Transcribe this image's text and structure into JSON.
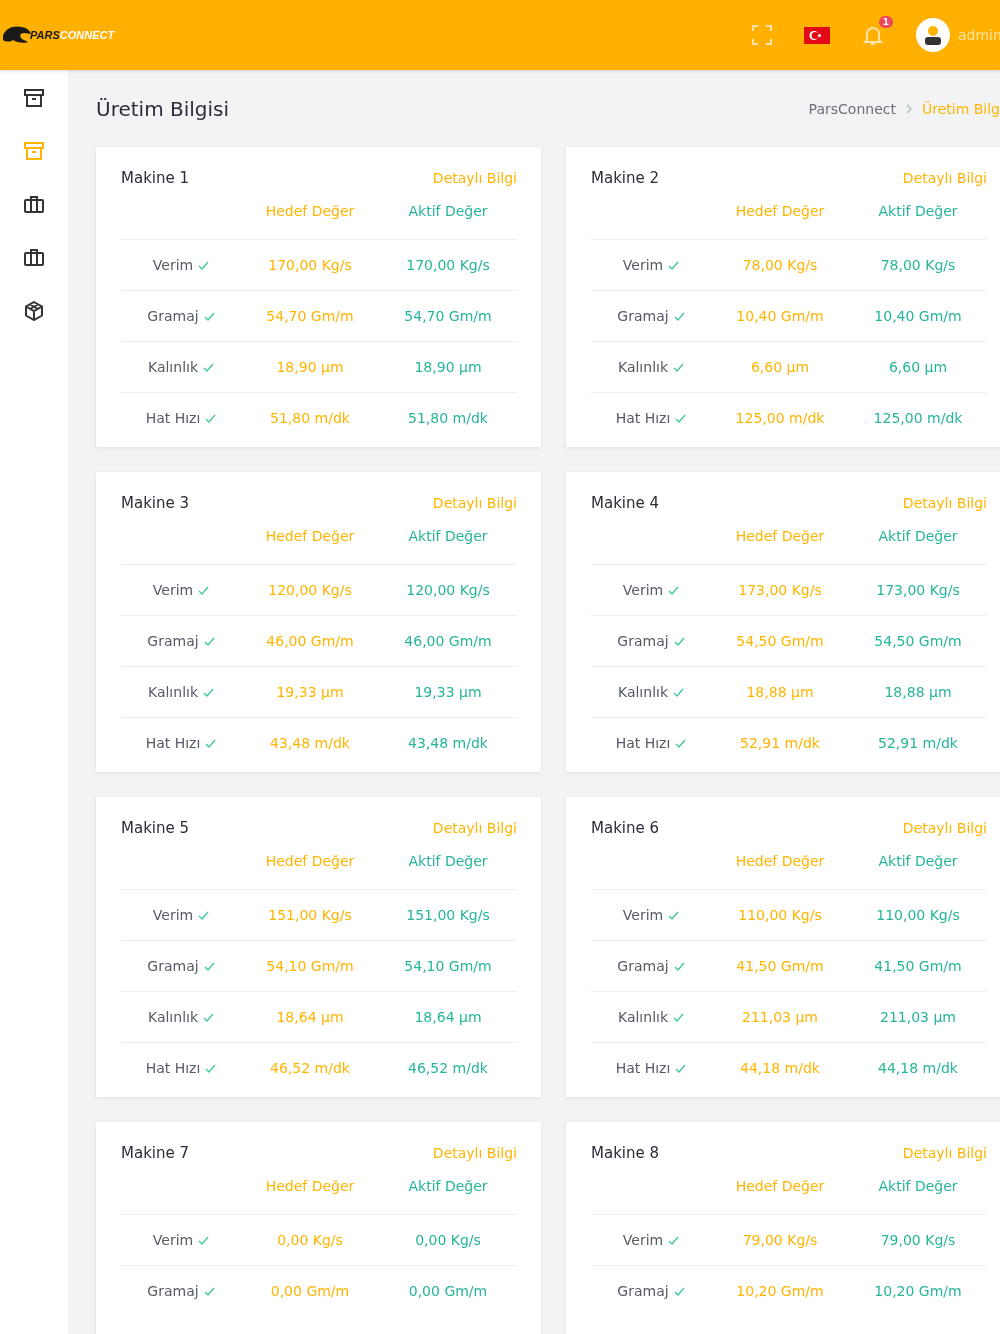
{
  "header": {
    "brand": {
      "first": "PARS",
      "second": "CONNECT"
    },
    "notifications": "1",
    "user": "admin"
  },
  "sidebar": {
    "items": [
      {
        "kind": "archive",
        "selected": false
      },
      {
        "kind": "archive",
        "selected": true
      },
      {
        "kind": "briefcase",
        "selected": false
      },
      {
        "kind": "briefcase",
        "selected": false
      },
      {
        "kind": "cube",
        "selected": false
      }
    ]
  },
  "page": {
    "title": "Üretim Bilgisi",
    "breadcrumb": [
      {
        "label": "ParsConnect",
        "selected": false
      },
      {
        "label": "Üretim Bilg",
        "selected": true
      }
    ]
  },
  "machines": [
    {
      "name": "Makine 1",
      "link": "Detaylı Bilgi",
      "target_header": "Hedef Değer",
      "actual_header": "Aktif Değer",
      "rows": [
        {
          "label": "Verim",
          "ok": true,
          "target": "170,00 Kg/s",
          "actual": "170,00 Kg/s"
        },
        {
          "label": "Gramaj",
          "ok": true,
          "target": "54,70 Gm/m",
          "actual": "54,70 Gm/m"
        },
        {
          "label": "Kalınlık",
          "ok": true,
          "target": "18,90 µm",
          "actual": "18,90 µm"
        },
        {
          "label": "Hat Hızı",
          "ok": true,
          "target": "51,80 m/dk",
          "actual": "51,80 m/dk"
        }
      ]
    },
    {
      "name": "Makine 2",
      "link": "Detaylı Bilgi",
      "target_header": "Hedef Değer",
      "actual_header": "Aktif Değer",
      "rows": [
        {
          "label": "Verim",
          "ok": true,
          "target": "78,00 Kg/s",
          "actual": "78,00 Kg/s"
        },
        {
          "label": "Gramaj",
          "ok": true,
          "target": "10,40 Gm/m",
          "actual": "10,40 Gm/m"
        },
        {
          "label": "Kalınlık",
          "ok": true,
          "target": "6,60 µm",
          "actual": "6,60 µm"
        },
        {
          "label": "Hat Hızı",
          "ok": true,
          "target": "125,00 m/dk",
          "actual": "125,00 m/dk"
        }
      ]
    },
    {
      "name": "Makine 3",
      "link": "Detaylı Bilgi",
      "target_header": "Hedef Değer",
      "actual_header": "Aktif Değer",
      "rows": [
        {
          "label": "Verim",
          "ok": true,
          "target": "120,00 Kg/s",
          "actual": "120,00 Kg/s"
        },
        {
          "label": "Gramaj",
          "ok": true,
          "target": "46,00 Gm/m",
          "actual": "46,00 Gm/m"
        },
        {
          "label": "Kalınlık",
          "ok": true,
          "target": "19,33 µm",
          "actual": "19,33 µm"
        },
        {
          "label": "Hat Hızı",
          "ok": true,
          "target": "43,48 m/dk",
          "actual": "43,48 m/dk"
        }
      ]
    },
    {
      "name": "Makine 4",
      "link": "Detaylı Bilgi",
      "target_header": "Hedef Değer",
      "actual_header": "Aktif Değer",
      "rows": [
        {
          "label": "Verim",
          "ok": true,
          "target": "173,00 Kg/s",
          "actual": "173,00 Kg/s"
        },
        {
          "label": "Gramaj",
          "ok": true,
          "target": "54,50 Gm/m",
          "actual": "54,50 Gm/m"
        },
        {
          "label": "Kalınlık",
          "ok": true,
          "target": "18,88 µm",
          "actual": "18,88 µm"
        },
        {
          "label": "Hat Hızı",
          "ok": true,
          "target": "52,91 m/dk",
          "actual": "52,91 m/dk"
        }
      ]
    },
    {
      "name": "Makine 5",
      "link": "Detaylı Bilgi",
      "target_header": "Hedef Değer",
      "actual_header": "Aktif Değer",
      "rows": [
        {
          "label": "Verim",
          "ok": true,
          "target": "151,00 Kg/s",
          "actual": "151,00 Kg/s"
        },
        {
          "label": "Gramaj",
          "ok": true,
          "target": "54,10 Gm/m",
          "actual": "54,10 Gm/m"
        },
        {
          "label": "Kalınlık",
          "ok": true,
          "target": "18,64 µm",
          "actual": "18,64 µm"
        },
        {
          "label": "Hat Hızı",
          "ok": true,
          "target": "46,52 m/dk",
          "actual": "46,52 m/dk"
        }
      ]
    },
    {
      "name": "Makine 6",
      "link": "Detaylı Bilgi",
      "target_header": "Hedef Değer",
      "actual_header": "Aktif Değer",
      "rows": [
        {
          "label": "Verim",
          "ok": true,
          "target": "110,00 Kg/s",
          "actual": "110,00 Kg/s"
        },
        {
          "label": "Gramaj",
          "ok": true,
          "target": "41,50 Gm/m",
          "actual": "41,50 Gm/m"
        },
        {
          "label": "Kalınlık",
          "ok": true,
          "target": "211,03 µm",
          "actual": "211,03 µm"
        },
        {
          "label": "Hat Hızı",
          "ok": true,
          "target": "44,18 m/dk",
          "actual": "44,18 m/dk"
        }
      ]
    },
    {
      "name": "Makine 7",
      "link": "Detaylı Bilgi",
      "target_header": "Hedef Değer",
      "actual_header": "Aktif Değer",
      "rows": [
        {
          "label": "Verim",
          "ok": true,
          "target": "0,00 Kg/s",
          "actual": "0,00 Kg/s"
        },
        {
          "label": "Gramaj",
          "ok": true,
          "target": "0,00 Gm/m",
          "actual": "0,00 Gm/m"
        }
      ]
    },
    {
      "name": "Makine 8",
      "link": "Detaylı Bilgi",
      "target_header": "Hedef Değer",
      "actual_header": "Aktif Değer",
      "rows": [
        {
          "label": "Verim",
          "ok": true,
          "target": "79,00 Kg/s",
          "actual": "79,00 Kg/s"
        },
        {
          "label": "Gramaj",
          "ok": true,
          "target": "10,20 Gm/m",
          "actual": "10,20 Gm/m"
        }
      ]
    }
  ]
}
